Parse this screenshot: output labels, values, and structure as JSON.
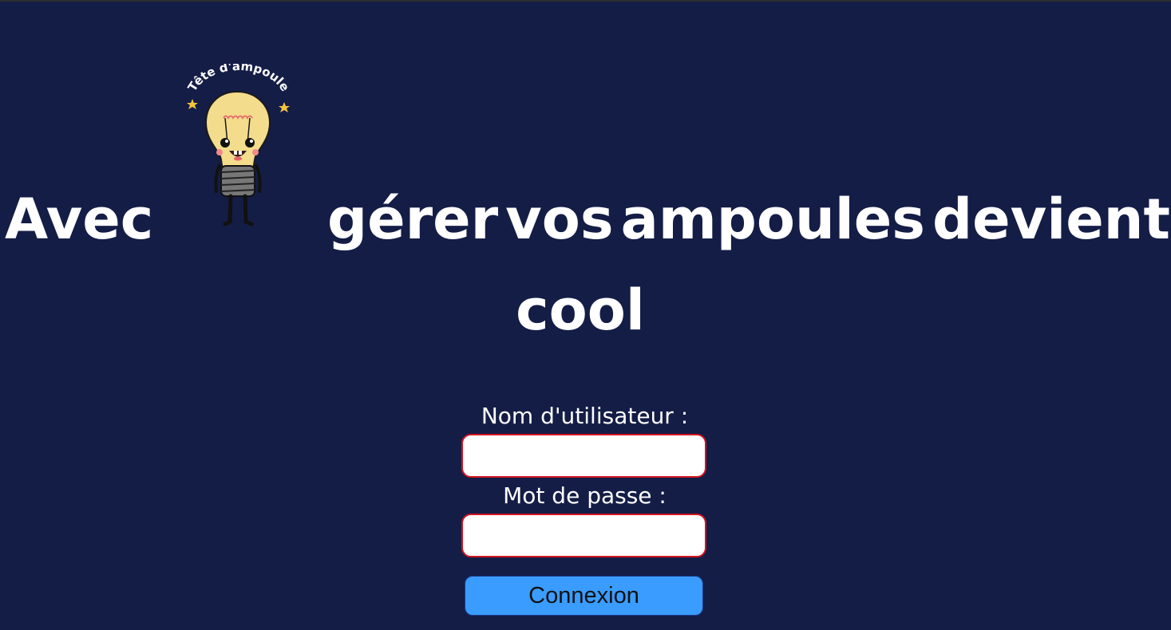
{
  "colors": {
    "background": "#141d46",
    "text": "#ffffff",
    "input_border": "#d3141f",
    "button_bg": "#3a9cff",
    "bulb_glass": "#f3dc8c"
  },
  "logo": {
    "caption": "Tête d'ampoule",
    "icon": "lightbulb-mascot-icon"
  },
  "headline": {
    "word_before_logo": "Avec",
    "words_after_logo": [
      "gérer",
      "vos",
      "ampoules",
      "devient"
    ],
    "last_line": "cool"
  },
  "login": {
    "username_label": "Nom d'utilisateur :",
    "username_value": "",
    "password_label": "Mot de passe :",
    "password_value": "",
    "submit_label": "Connexion"
  }
}
